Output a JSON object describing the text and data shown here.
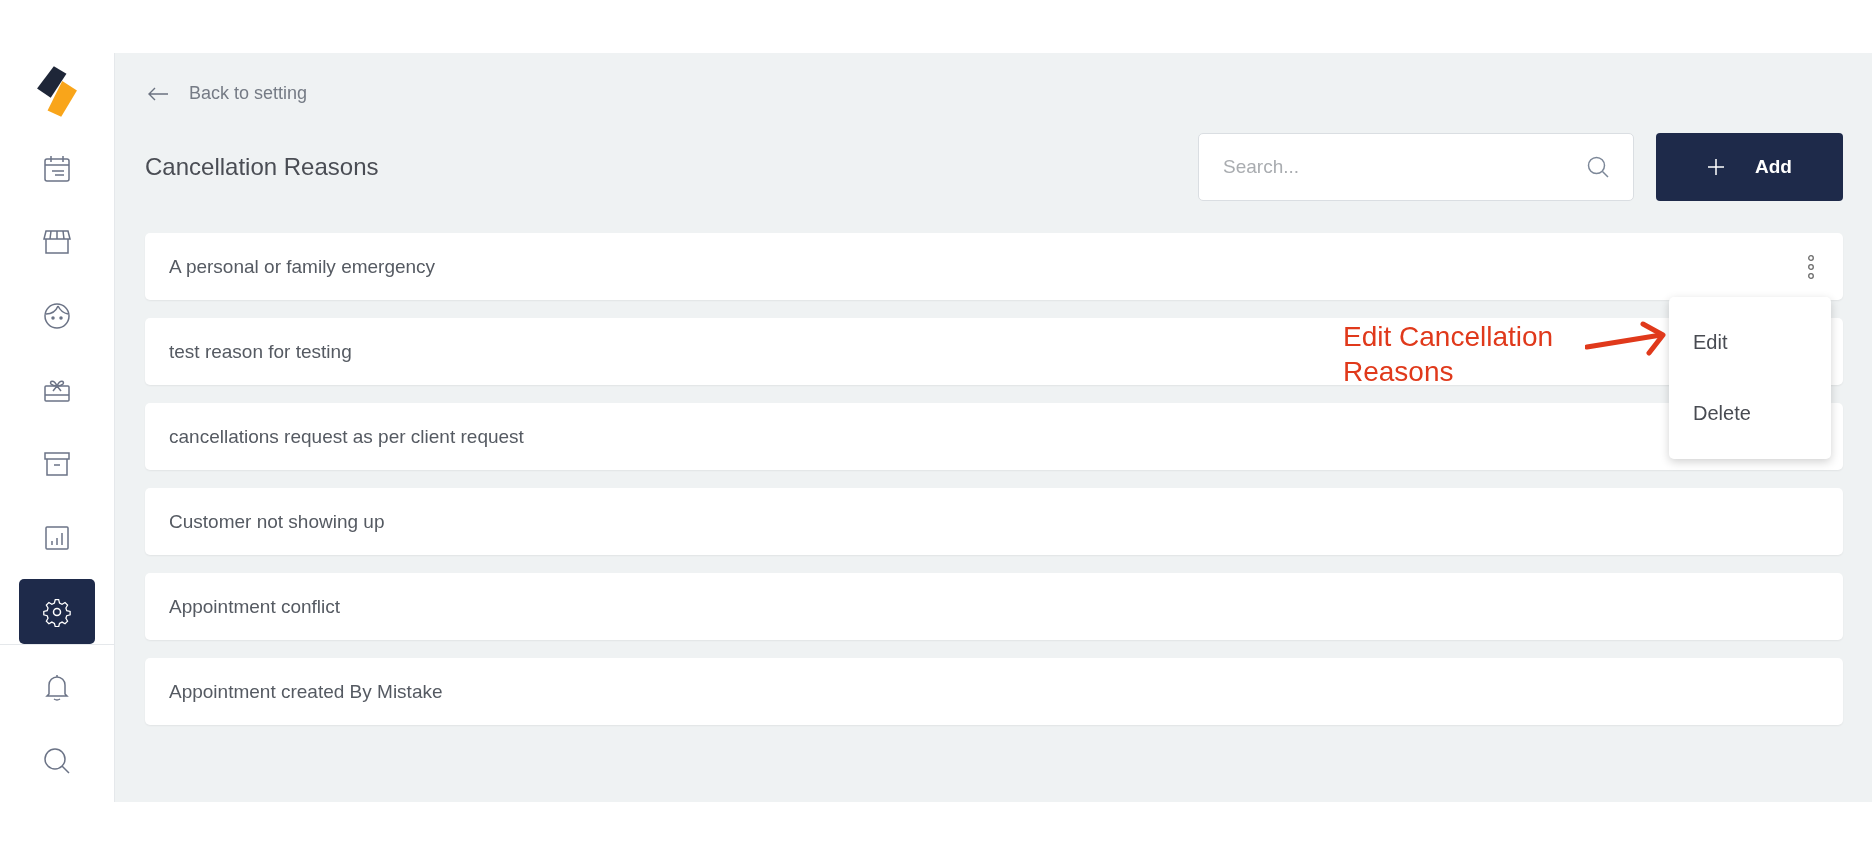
{
  "sidebar": {
    "items": [
      {
        "kind": "calendar",
        "selected": false
      },
      {
        "kind": "store",
        "selected": false
      },
      {
        "kind": "face",
        "selected": false
      },
      {
        "kind": "gift",
        "selected": false
      },
      {
        "kind": "archive",
        "selected": false
      },
      {
        "kind": "chart",
        "selected": false
      },
      {
        "kind": "settings",
        "selected": true
      }
    ],
    "bottom_items": [
      {
        "kind": "bell",
        "selected": false
      },
      {
        "kind": "search",
        "selected": false
      }
    ]
  },
  "back_link": "Back to setting",
  "title": "Cancellation Reasons",
  "search": {
    "placeholder": "Search..."
  },
  "add_button": "Add",
  "rows": [
    {
      "text": "A personal or family emergency",
      "menu_open": true
    },
    {
      "text": "test reason for testing",
      "menu_open": false
    },
    {
      "text": "cancellations request as per client request",
      "menu_open": false
    },
    {
      "text": "Customer not showing up",
      "menu_open": false
    },
    {
      "text": "Appointment conflict",
      "menu_open": false
    },
    {
      "text": "Appointment created By Mistake",
      "menu_open": false
    }
  ],
  "row_menu": [
    "Edit",
    "Delete"
  ],
  "annotation": "Edit Cancellation Reasons"
}
